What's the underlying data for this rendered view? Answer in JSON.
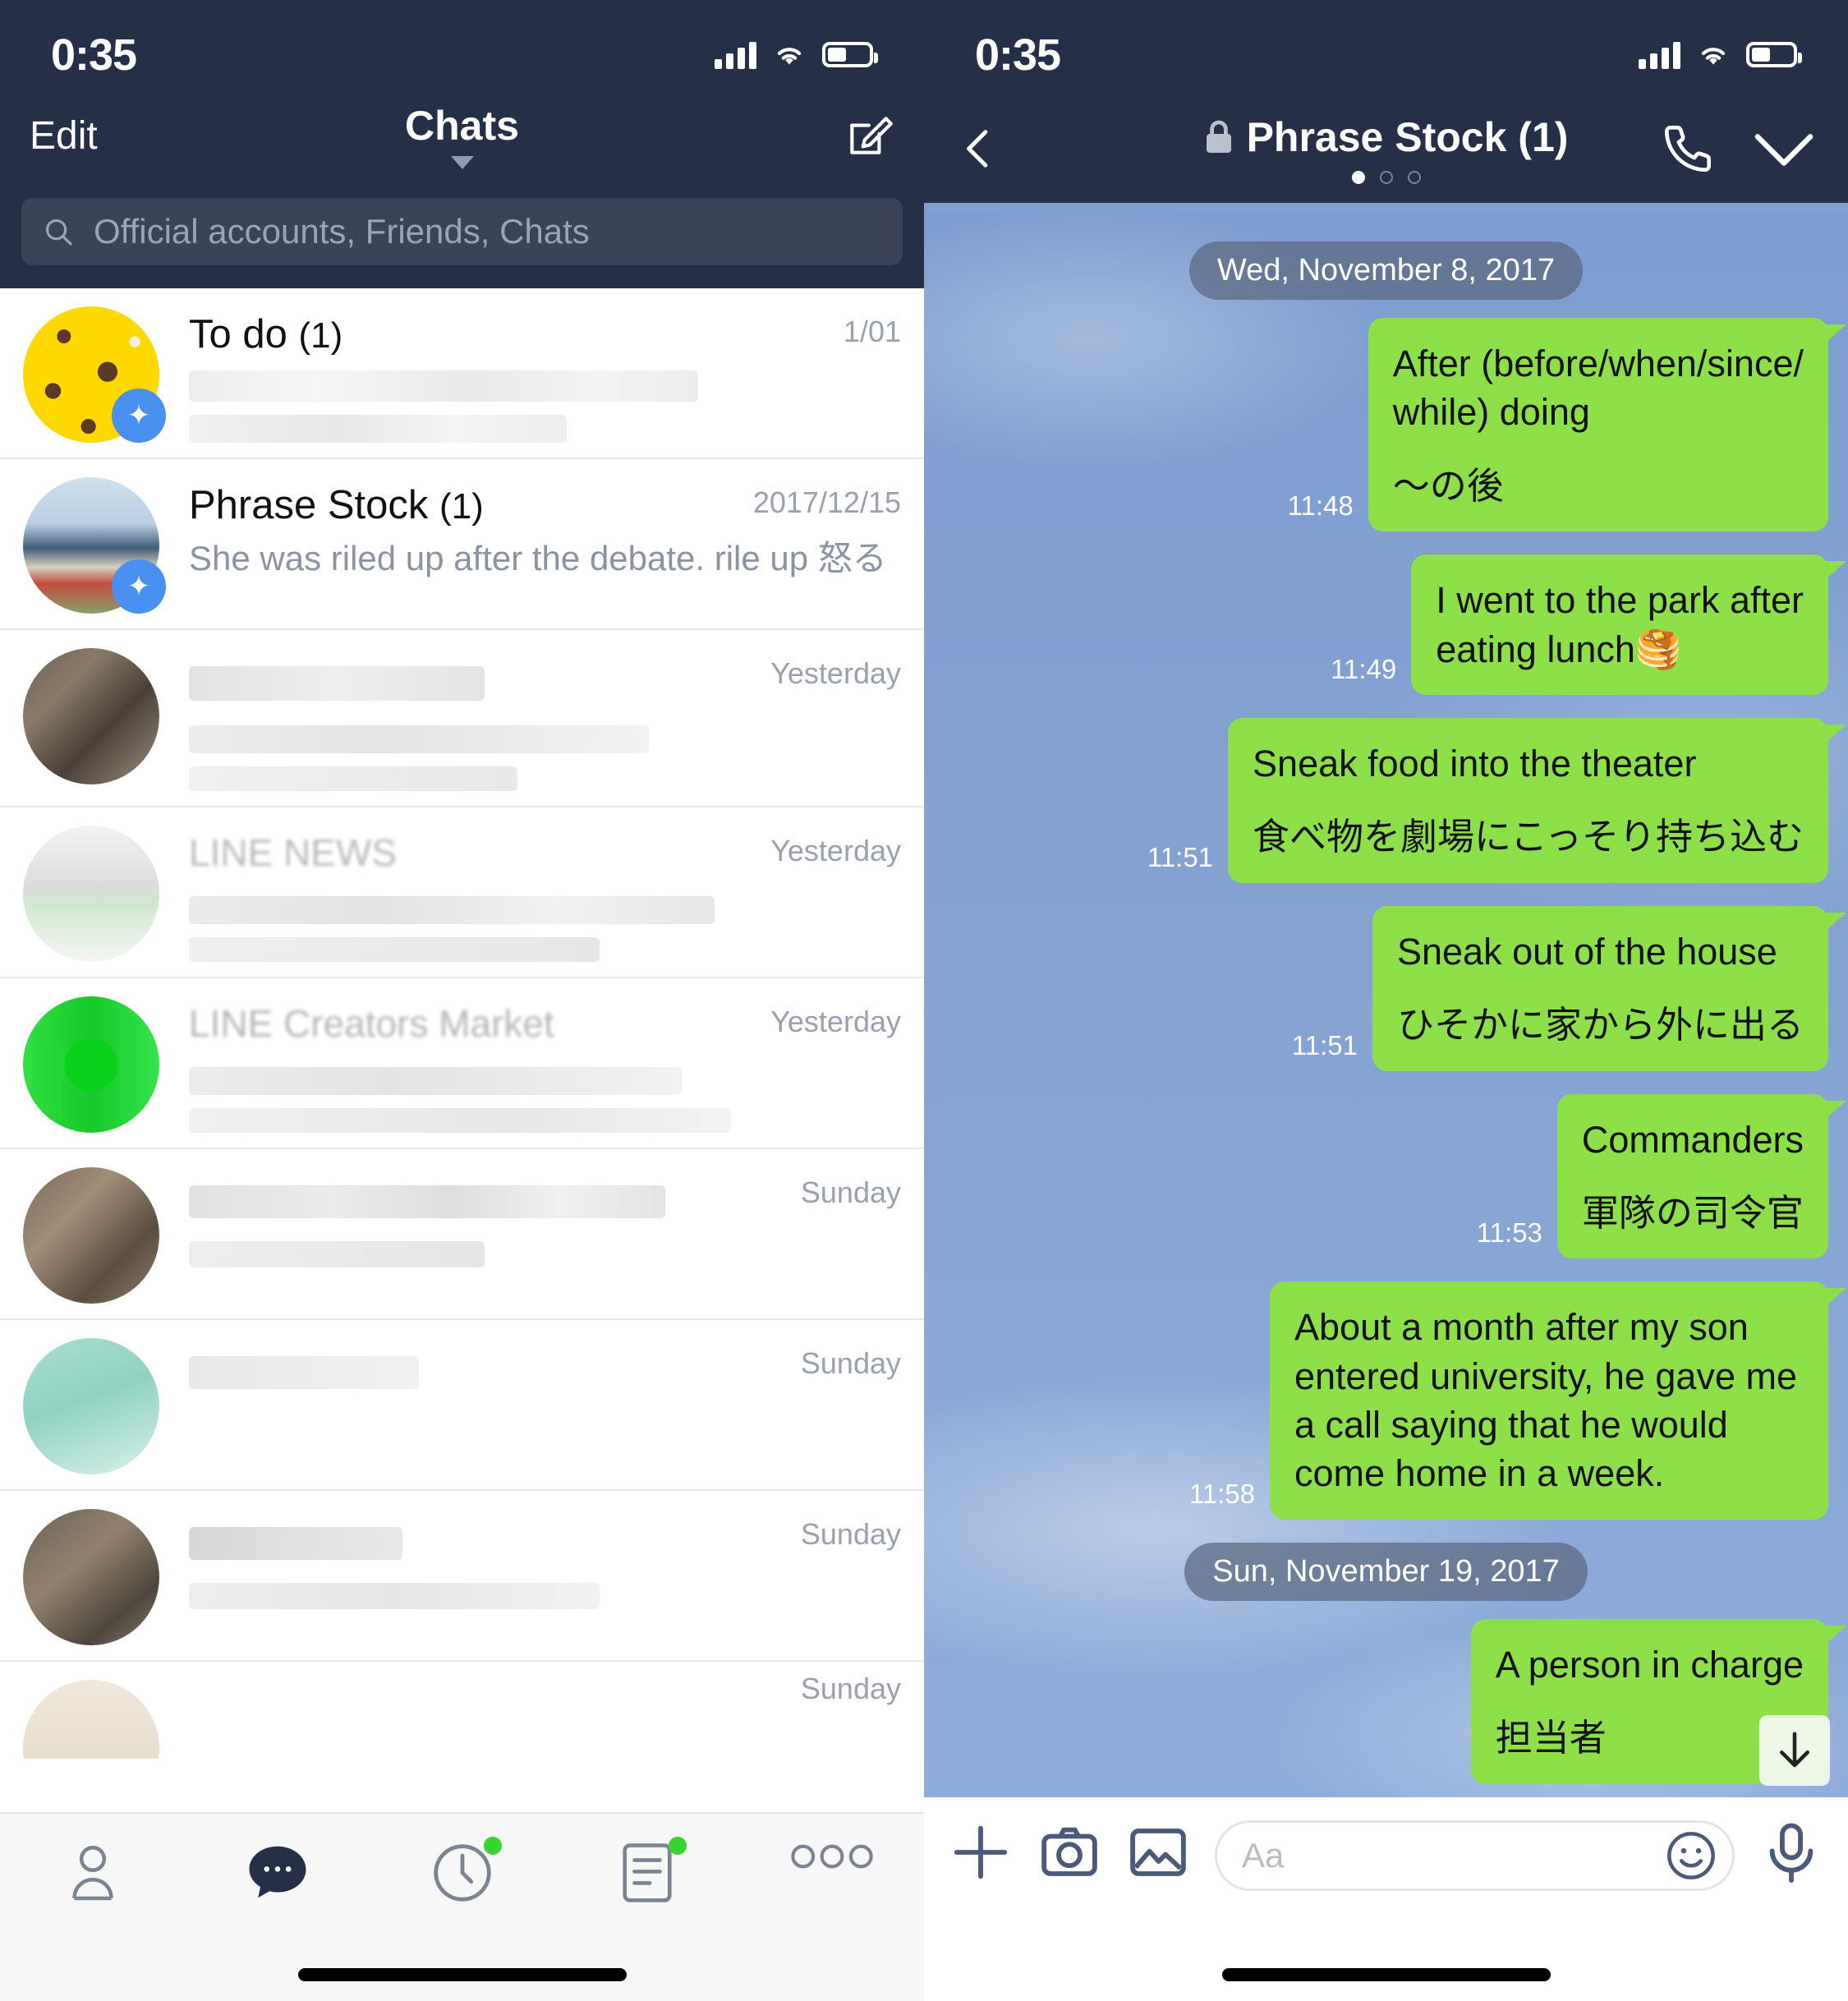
{
  "status": {
    "time": "0:35",
    "signal_icon": "cellular-bars-icon",
    "wifi_icon": "wifi-icon",
    "battery_icon": "battery-icon"
  },
  "colors": {
    "nav_bg": "#262f48",
    "bubble_green": "#8de048",
    "pin_blue": "#4a90f0",
    "badge_green": "#38d430",
    "chat_bg": "#84a3d2"
  },
  "left_pane": {
    "nav": {
      "edit_label": "Edit",
      "title": "Chats",
      "caret_icon": "chevron-down-icon",
      "compose_icon": "compose-icon"
    },
    "search": {
      "placeholder": "Official accounts, Friends, Chats",
      "icon": "search-icon"
    },
    "rows": [
      {
        "name": "To do",
        "count": "(1)",
        "time": "1/01",
        "preview": "",
        "pinned": true,
        "blurred": true
      },
      {
        "name": "Phrase Stock",
        "count": "(1)",
        "time": "2017/12/15",
        "preview": "She was riled up after the debate. rile up 怒る",
        "pinned": true,
        "blurred": false
      },
      {
        "name": "",
        "count": "",
        "time": "Yesterday",
        "preview": "",
        "pinned": false,
        "blurred": true
      },
      {
        "name": "LINE NEWS",
        "count": "",
        "time": "Yesterday",
        "preview": "",
        "pinned": false,
        "blurred": true
      },
      {
        "name": "LINE Creators Market",
        "count": "",
        "time": "Yesterday",
        "preview": "",
        "pinned": false,
        "blurred": true
      },
      {
        "name": "",
        "count": "",
        "time": "Sunday",
        "preview": "",
        "pinned": false,
        "blurred": true
      },
      {
        "name": "",
        "count": "",
        "time": "Sunday",
        "preview": "",
        "pinned": false,
        "blurred": true
      },
      {
        "name": "",
        "count": "",
        "time": "Sunday",
        "preview": "",
        "pinned": false,
        "blurred": true
      },
      {
        "name": "",
        "count": "",
        "time": "Sunday",
        "preview": "",
        "pinned": false,
        "blurred": true
      }
    ],
    "tabs": [
      {
        "name": "friends",
        "icon": "person-icon",
        "badge": false
      },
      {
        "name": "chats",
        "icon": "chat-bubble-icon",
        "badge": false,
        "active": true
      },
      {
        "name": "timeline",
        "icon": "clock-icon",
        "badge": true
      },
      {
        "name": "news",
        "icon": "news-icon",
        "badge": true
      },
      {
        "name": "more",
        "icon": "ellipsis-icon",
        "badge": false
      }
    ]
  },
  "right_pane": {
    "nav": {
      "back_icon": "chevron-left-icon",
      "lock_icon": "lock-icon",
      "title": "Phrase Stock (1)",
      "call_icon": "phone-icon",
      "menu_icon": "chevron-down-icon",
      "page_dots": 3,
      "active_dot": 1
    },
    "messages": [
      {
        "type": "date",
        "text": "Wed, November 8, 2017"
      },
      {
        "type": "out",
        "time": "11:48",
        "line1": "After (before/when/since/",
        "line2": "while) doing",
        "jp": "〜の後"
      },
      {
        "type": "out",
        "time": "11:49",
        "line1": "I went to the park after",
        "line2": "eating lunch🥞",
        "jp": ""
      },
      {
        "type": "out",
        "time": "11:51",
        "line1": "Sneak food into the theater",
        "line2": "",
        "jp": "食べ物を劇場にこっそり持ち込む"
      },
      {
        "type": "out",
        "time": "11:51",
        "line1": "Sneak out of the house",
        "line2": "",
        "jp": "ひそかに家から外に出る"
      },
      {
        "type": "out",
        "time": "11:53",
        "line1": "Commanders",
        "line2": "",
        "jp": "軍隊の司令官"
      },
      {
        "type": "out",
        "time": "11:58",
        "line1": "About a month after my son entered university, he gave me a call saying that he would come home in a week.",
        "line2": "",
        "jp": ""
      },
      {
        "type": "date",
        "text": "Sun, November 19, 2017"
      },
      {
        "type": "out",
        "time": "",
        "line1": "A person in charge",
        "line2": "",
        "jp": "担当者"
      }
    ],
    "scroll_down_icon": "arrow-down-icon",
    "input": {
      "plus_icon": "plus-icon",
      "camera_icon": "camera-icon",
      "photo_icon": "photo-icon",
      "placeholder": "Aa",
      "emoji_icon": "smiley-icon",
      "mic_icon": "microphone-icon"
    }
  }
}
